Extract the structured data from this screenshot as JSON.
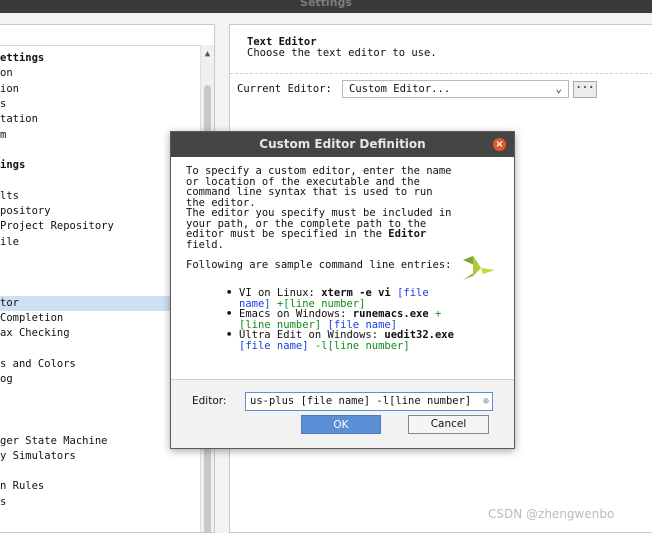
{
  "window": {
    "title": "Settings"
  },
  "tree": {
    "items": [
      {
        "label": "ettings",
        "group": true
      },
      {
        "label": "on"
      },
      {
        "label": "ion"
      },
      {
        "label": "s"
      },
      {
        "label": "tation"
      },
      {
        "label": "m"
      },
      {
        "label": ""
      },
      {
        "label": "ings",
        "group": true
      },
      {
        "label": ""
      },
      {
        "label": "lts"
      },
      {
        "label": "pository"
      },
      {
        "label": "Project Repository"
      },
      {
        "label": "ile"
      },
      {
        "label": ""
      },
      {
        "label": ""
      },
      {
        "label": ""
      },
      {
        "label": "tor",
        "selected": true
      },
      {
        "label": " Completion"
      },
      {
        "label": "ax Checking"
      },
      {
        "label": ""
      },
      {
        "label": "s and Colors"
      },
      {
        "label": "og"
      },
      {
        "label": ""
      },
      {
        "label": ""
      },
      {
        "label": ""
      },
      {
        "label": "ger State Machine"
      },
      {
        "label": "y Simulators"
      },
      {
        "label": ""
      },
      {
        "label": "n Rules"
      },
      {
        "label": "s"
      }
    ]
  },
  "text_editor": {
    "title": "Text Editor",
    "description": "Choose the text editor to use.",
    "current_editor_label": "Current Editor:",
    "current_editor_value": "Custom Editor...",
    "browse_label": "···"
  },
  "dialog": {
    "title": "Custom Editor Definition",
    "close_label": "×",
    "para1": "To specify a custom editor, enter the name or location of the executable and the command line syntax that is used to run the editor.",
    "para2_a": "The editor you specify must be included in your path, or the complete path to the editor must be specified in the",
    "para2_bold": "Editor",
    "para2_b": "field.",
    "para3": "Following are sample command line entries:",
    "examples": [
      {
        "prefix": "VI on Linux:",
        "cmd": "xterm -e vi",
        "arg1": "[file name]",
        "arg2": "+[line number]"
      },
      {
        "prefix": "Emacs on Windows:",
        "cmd": "runemacs.exe",
        "arg1": "+[line number]",
        "arg2": "[file name]"
      },
      {
        "prefix": "Ultra Edit on Windows:",
        "cmd": "uedit32.exe",
        "arg1": "[file name]",
        "arg2": "-l[line number]"
      }
    ],
    "editor_label": "Editor:",
    "editor_value": "us-plus [file name] -l[line number]",
    "ok_label": "OK",
    "cancel_label": "Cancel"
  },
  "watermark": "CSDN @zhengwenbo",
  "colors": {
    "accent": "#5b8fd6",
    "selection": "#cfe0f5",
    "dialog_title": "#454545"
  }
}
